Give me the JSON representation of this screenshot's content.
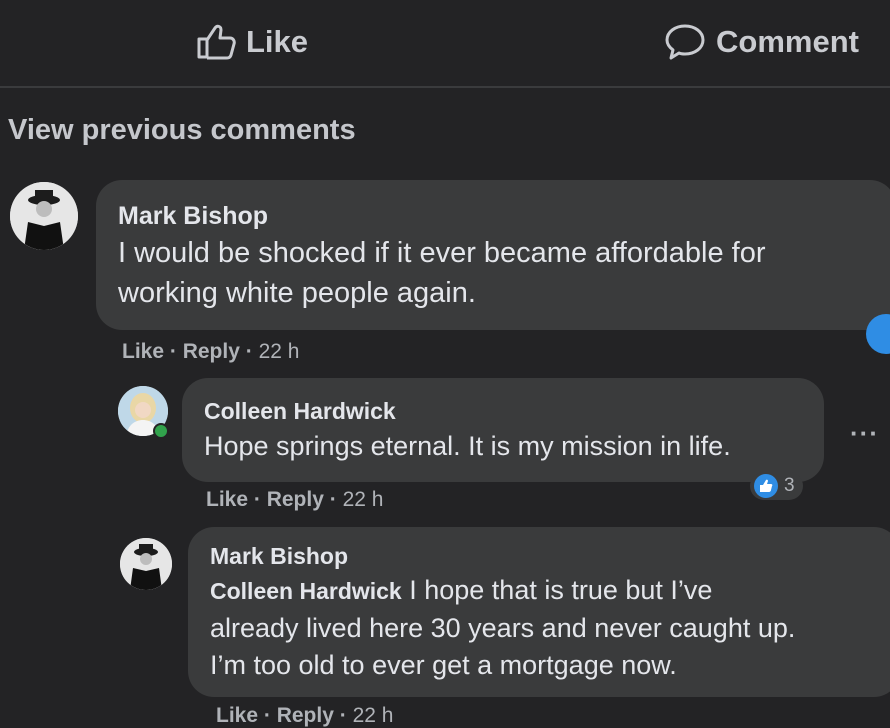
{
  "actions": {
    "like_label": "Like",
    "comment_label": "Comment"
  },
  "view_previous": "View previous comments",
  "comments": [
    {
      "author": "Mark Bishop",
      "lines": [
        "I would be shocked if it ever became affordable for",
        "working white people again."
      ],
      "like_label": "Like",
      "reply_label": "Reply",
      "time": "22 h"
    },
    {
      "author": "Colleen Hardwick",
      "lines": [
        "Hope springs eternal. It is my mission in life."
      ],
      "like_label": "Like",
      "reply_label": "Reply",
      "time": "22 h",
      "reaction_count": "3",
      "more_label": "···"
    },
    {
      "author": "Mark Bishop",
      "mention": "Colleen Hardwick",
      "lines": [
        " I hope that is true but I’ve",
        "already lived here 30 years and never caught up.",
        "I’m too old to ever get a mortgage now."
      ],
      "like_label": "Like",
      "reply_label": "Reply",
      "time": "22 h"
    }
  ],
  "icons": {
    "like": "thumbs-up-icon",
    "comment": "speech-bubble-icon",
    "reaction": "like-reaction-icon"
  },
  "colors": {
    "background": "#232325",
    "bubble": "#3a3b3c",
    "reaction": "#2f8de4",
    "online": "#31a24c"
  }
}
